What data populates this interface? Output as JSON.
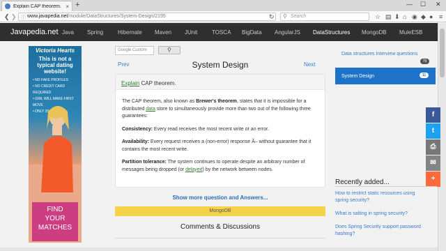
{
  "browser": {
    "tab_title": "Explain CAP theorem.",
    "tab_close": "×",
    "new_tab": "+",
    "url_host": "www.javapedia.net",
    "url_path": "/module/DataStructures/System-Design/2195",
    "search_placeholder": "Search",
    "window_controls": [
      "—",
      "☐",
      "✕"
    ],
    "toolbar_icons": [
      "star-icon",
      "reading-list-icon",
      "download-icon",
      "home-icon",
      "pocket-icon",
      "shield-icon",
      "user-icon",
      "menu-icon"
    ]
  },
  "site": {
    "brand": "Javapedia.net",
    "nav_items": [
      "Java",
      "Spring",
      "Hibernate",
      "Maven",
      "JUnit",
      "TOSCA",
      "BigData",
      "AngularJS",
      "DataStructures",
      "MongoDB",
      "MuleESB"
    ],
    "active_nav": "DataStructures"
  },
  "ad": {
    "logo": "Victoria Hearts",
    "headline": "This is not a typical dating website!",
    "bullets": [
      "• NO FAKE PROFILES",
      "• NO CREDIT CARD REQUIRED",
      "• GIRL WILL MAKE FIRST MOVE",
      "• ONLY 35+"
    ],
    "cta_line1": "FIND",
    "cta_line2": "YOUR",
    "cta_line3": "MATCHES"
  },
  "search": {
    "placeholder": "Google Custom"
  },
  "pager": {
    "prev": "Prev",
    "next": "Next",
    "title": "System Design"
  },
  "question": {
    "keyword": "Explain",
    "rest": " CAP theorem."
  },
  "answer": {
    "p1_a": "The CAP theorem, also known as ",
    "p1_b": "Brewer's theorem",
    "p1_c": ", states that it is impossible for a distributed ",
    "p1_link": "data",
    "p1_d": " store to simultaneously provide more than two out of the following three guarantees:",
    "c_label": "Consistency:",
    "c_text": " Every read receives the most recent write or an error.",
    "a_label": "Availability:",
    "a_text": " Every request receives a (non-error) response Â– without guarantee that it contains the most recent write.",
    "p_label": "Partition tolerance:",
    "p_text_a": " The system continues to operate despite an arbitrary number of messages being dropped (or ",
    "p_link": "delayed",
    "p_text_b": ") by the network between nodes."
  },
  "more_link": "Show more question and Answers...",
  "tag": "MongoDB",
  "comments_heading": "Comments & Discussions",
  "sidebar": {
    "link1": "Data structures Interview questions",
    "badge1": "79",
    "active": "System Design",
    "badge2": "11"
  },
  "share_buttons": [
    {
      "icon": "facebook-icon",
      "glyph": "f",
      "color": "#3b5998"
    },
    {
      "icon": "twitter-icon",
      "glyph": "t",
      "color": "#1da1f2"
    },
    {
      "icon": "print-icon",
      "glyph": "⎙",
      "color": "#777777"
    },
    {
      "icon": "mail-icon",
      "glyph": "✉",
      "color": "#848484"
    },
    {
      "icon": "plus-icon",
      "glyph": "+",
      "color": "#ff6a3d"
    }
  ],
  "recent": {
    "title": "Recently added...",
    "items": [
      "How to restrict static resources using spring security?",
      "What is salting in spring security?",
      "Does Spring Security support password hashing?"
    ]
  }
}
